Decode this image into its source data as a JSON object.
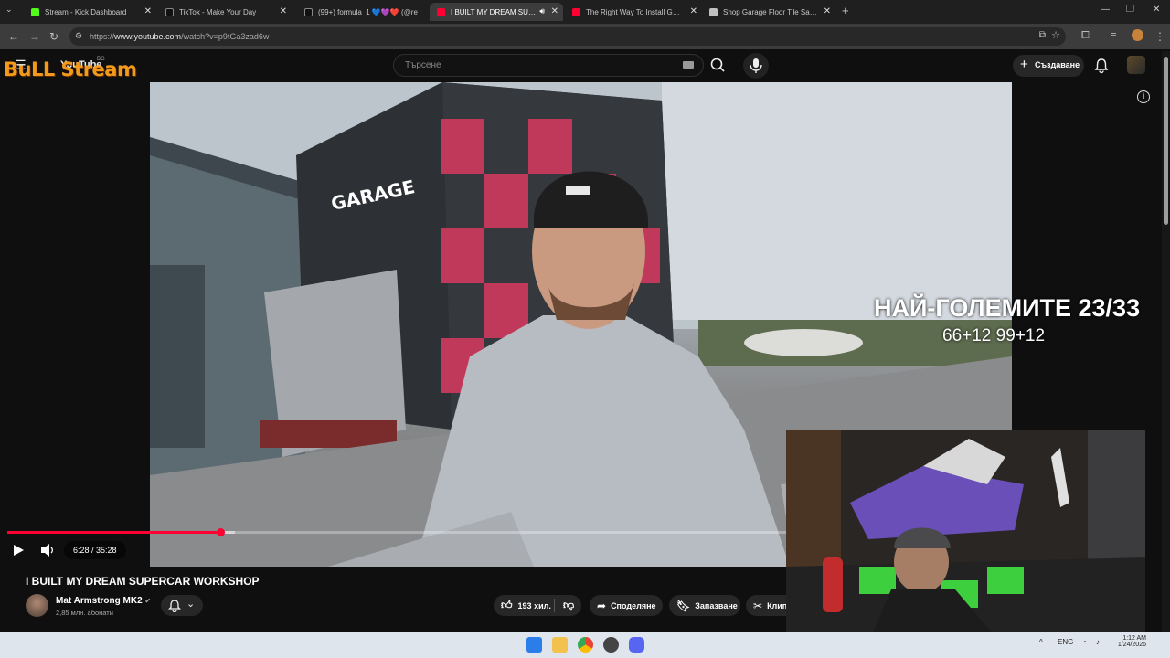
{
  "browser": {
    "tabs": [
      {
        "title": "Stream - Kick Dashboard",
        "favicon_color": "#53fc18",
        "active": false
      },
      {
        "title": "TikTok - Make Your Day",
        "favicon_color": "#111111",
        "active": false
      },
      {
        "title": "(99+) formula_1 💙💜❤️ (@re",
        "favicon_color": "#111111",
        "active": false
      },
      {
        "title": "I BUILT MY DREAM SUPERC",
        "favicon_color": "#ff0033",
        "active": true
      },
      {
        "title": "The Right Way To Install Garag",
        "favicon_color": "#ff0033",
        "active": false
      },
      {
        "title": "Shop Garage Floor Tile Sample",
        "favicon_color": "#c0c0c0",
        "active": false
      }
    ],
    "url_prefix": "https://",
    "url_host": "www.youtube.com",
    "url_path": "/watch?v=p9tGa3zad6w"
  },
  "overlay": {
    "logo_text": "BuLL Stream",
    "score_title": "НАЙ-ГОЛЕМИТЕ 23/33",
    "score_sub": "66+12 99+12"
  },
  "youtube": {
    "logo_text": "YouTube",
    "logo_country": "BG",
    "search_placeholder": "Търсене",
    "create_label": "Създаване"
  },
  "player": {
    "current_time": "6:28",
    "duration": "35:28",
    "time_display": "6:28 / 35:28",
    "progress_fraction": 0.2735,
    "buffered_fraction": 0.292
  },
  "video": {
    "title": "I BUILT MY DREAM SUPERCAR WORKSHOP",
    "channel": "Mat Armstrong MK2",
    "subscribers": "2,85 млн. абонати",
    "likes": "193 хил.",
    "share_label": "Споделяне",
    "save_label": "Запазване",
    "clip_label": "Клип"
  },
  "taskbar": {
    "lang": "ENG",
    "time": "1:12 AM",
    "date": "1/24/2026"
  },
  "colors": {
    "accent_red": "#ff0033",
    "logo_orange": "#f39a1c"
  }
}
